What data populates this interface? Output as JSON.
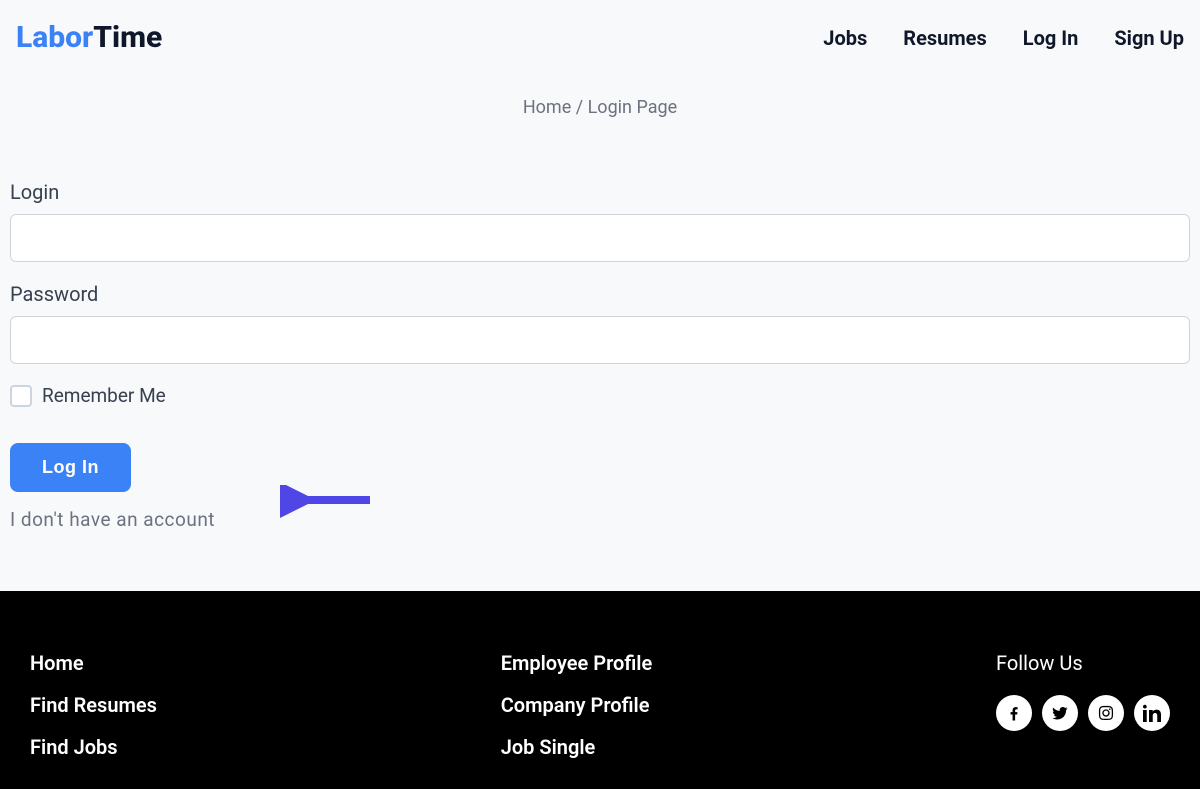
{
  "header": {
    "logo_part1": "Labor",
    "logo_part2": "Time",
    "nav": {
      "jobs": "Jobs",
      "resumes": "Resumes",
      "login": "Log In",
      "signup": "Sign Up"
    }
  },
  "breadcrumb": {
    "home": "Home",
    "separator": " / ",
    "current": "Login Page"
  },
  "form": {
    "login_label": "Login",
    "password_label": "Password",
    "remember_label": "Remember Me",
    "submit_label": "Log In",
    "no_account": "I don't have an account"
  },
  "footer": {
    "col1": {
      "home": "Home",
      "find_resumes": "Find Resumes",
      "find_jobs": "Find Jobs"
    },
    "col2": {
      "employee_profile": "Employee Profile",
      "company_profile": "Company Profile",
      "job_single": "Job Single"
    },
    "follow": "Follow Us"
  }
}
